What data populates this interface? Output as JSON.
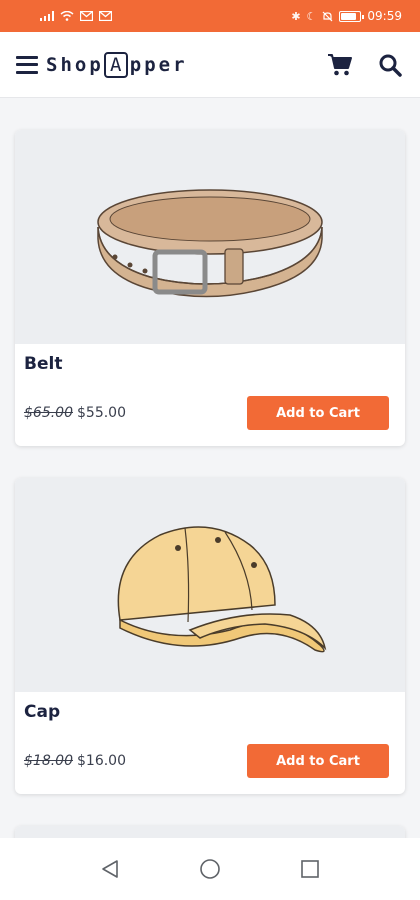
{
  "status_bar": {
    "time": "09:59",
    "battery_level": 0.8,
    "left_icons": [
      "signal-icon",
      "wifi-icon",
      "mail-icon",
      "mail-icon"
    ],
    "right_icons": [
      "bluetooth-icon",
      "moon-icon",
      "mute-icon",
      "battery-icon"
    ]
  },
  "app_bar": {
    "logo_part1": "Shop",
    "logo_box_letter": "A",
    "logo_part2": "pper",
    "menu_icon": "hamburger-menu-icon",
    "cart_icon": "cart-icon",
    "search_icon": "search-icon"
  },
  "products": [
    {
      "name": "Belt",
      "old_price": "$65.00",
      "price": "$55.00",
      "button_label": "Add to Cart",
      "image_icon": "belt-illustration"
    },
    {
      "name": "Cap",
      "old_price": "$18.00",
      "price": "$16.00",
      "button_label": "Add to Cart",
      "image_icon": "cap-illustration"
    }
  ],
  "nav_bar": {
    "icons": [
      "back-icon",
      "home-icon",
      "recents-icon"
    ]
  },
  "colors": {
    "accent": "#f26a36",
    "brand_text": "#1c2340",
    "image_bg": "#eceef1"
  }
}
